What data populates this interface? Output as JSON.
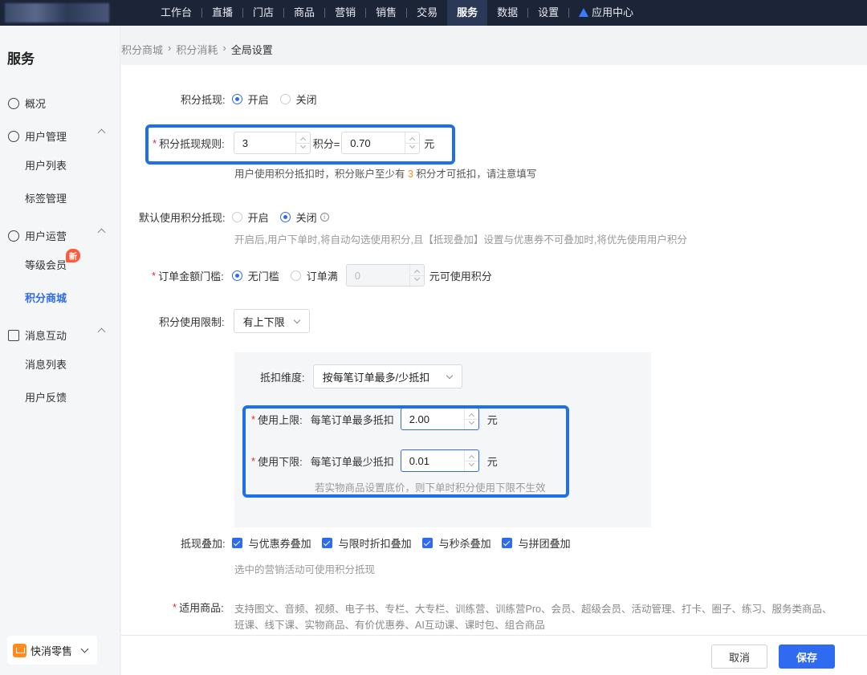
{
  "topnav": {
    "items": [
      "工作台",
      "直播",
      "门店",
      "商品",
      "营销",
      "销售",
      "交易",
      "服务",
      "数据",
      "设置",
      "应用中心"
    ],
    "active": "服务"
  },
  "sidebar": {
    "title": "服务",
    "overview": "概况",
    "groups": [
      {
        "label": "用户管理",
        "items": [
          "用户列表",
          "标签管理"
        ]
      },
      {
        "label": "用户运营",
        "items": [
          "等级会员",
          "积分商城"
        ]
      },
      {
        "label": "消息互动",
        "items": [
          "消息列表",
          "用户反馈"
        ]
      }
    ],
    "new_badge": "新",
    "active_item": "积分商城",
    "store": "快消零售"
  },
  "breadcrumb": [
    "积分商城",
    "积分消耗",
    "全局设置"
  ],
  "form": {
    "deduct": {
      "label": "积分抵现:",
      "on": "开启",
      "off": "关闭",
      "selected": "开启"
    },
    "rule": {
      "label": "积分抵现规则:",
      "points": "3",
      "mid": "积分=",
      "amount": "0.70",
      "unit": "元",
      "hint_pre": "用户使用积分抵扣时，积分账户至少有 ",
      "hint_num": "3",
      "hint_post": " 积分才可抵扣，请注意填写"
    },
    "default_use": {
      "label": "默认使用积分抵现:",
      "on": "开启",
      "off": "关闭",
      "selected": "关闭",
      "hint": "开启后,用户下单时,将自动勾选使用积分,且【抵现叠加】设置与优惠券不可叠加时,将优先使用用户积分"
    },
    "threshold": {
      "label": "订单金额门槛:",
      "none": "无门槛",
      "full": "订单满",
      "value": "0",
      "suffix": "元可使用积分",
      "selected": "无门槛"
    },
    "limit": {
      "label": "积分使用限制:",
      "value": "有上下限"
    },
    "dimension": {
      "label": "抵扣维度:",
      "value": "按每笔订单最多/少抵扣"
    },
    "upper": {
      "label": "使用上限:",
      "desc": "每笔订单最多抵扣",
      "value": "2.00",
      "unit": "元"
    },
    "lower": {
      "label": "使用下限:",
      "desc": "每笔订单最少抵扣",
      "value": "0.01",
      "unit": "元",
      "hint": "若实物商品设置底价，则下单时积分使用下限不生效"
    },
    "stack": {
      "label": "抵现叠加:",
      "options": [
        "与优惠券叠加",
        "与限时折扣叠加",
        "与秒杀叠加",
        "与拼团叠加"
      ],
      "hint": "选中的营销活动可使用积分抵现"
    },
    "goods": {
      "label": "适用商品:",
      "line1": "支持图文、音频、视频、电子书、专栏、大专栏、训练营、训练营Pro、会员、超级会员、活动管理、打卡、圈子、练习、服务类商品、",
      "line2": "班课、线下课、实物商品、有价优惠券、AI互动课、课时包、组合商品"
    }
  },
  "footer": {
    "cancel": "取消",
    "save": "保存"
  },
  "colors": {
    "primary": "#2f6bf0",
    "highlight": "#1e6fe8",
    "topbar": "#1c2438",
    "required": "#f5222d"
  }
}
